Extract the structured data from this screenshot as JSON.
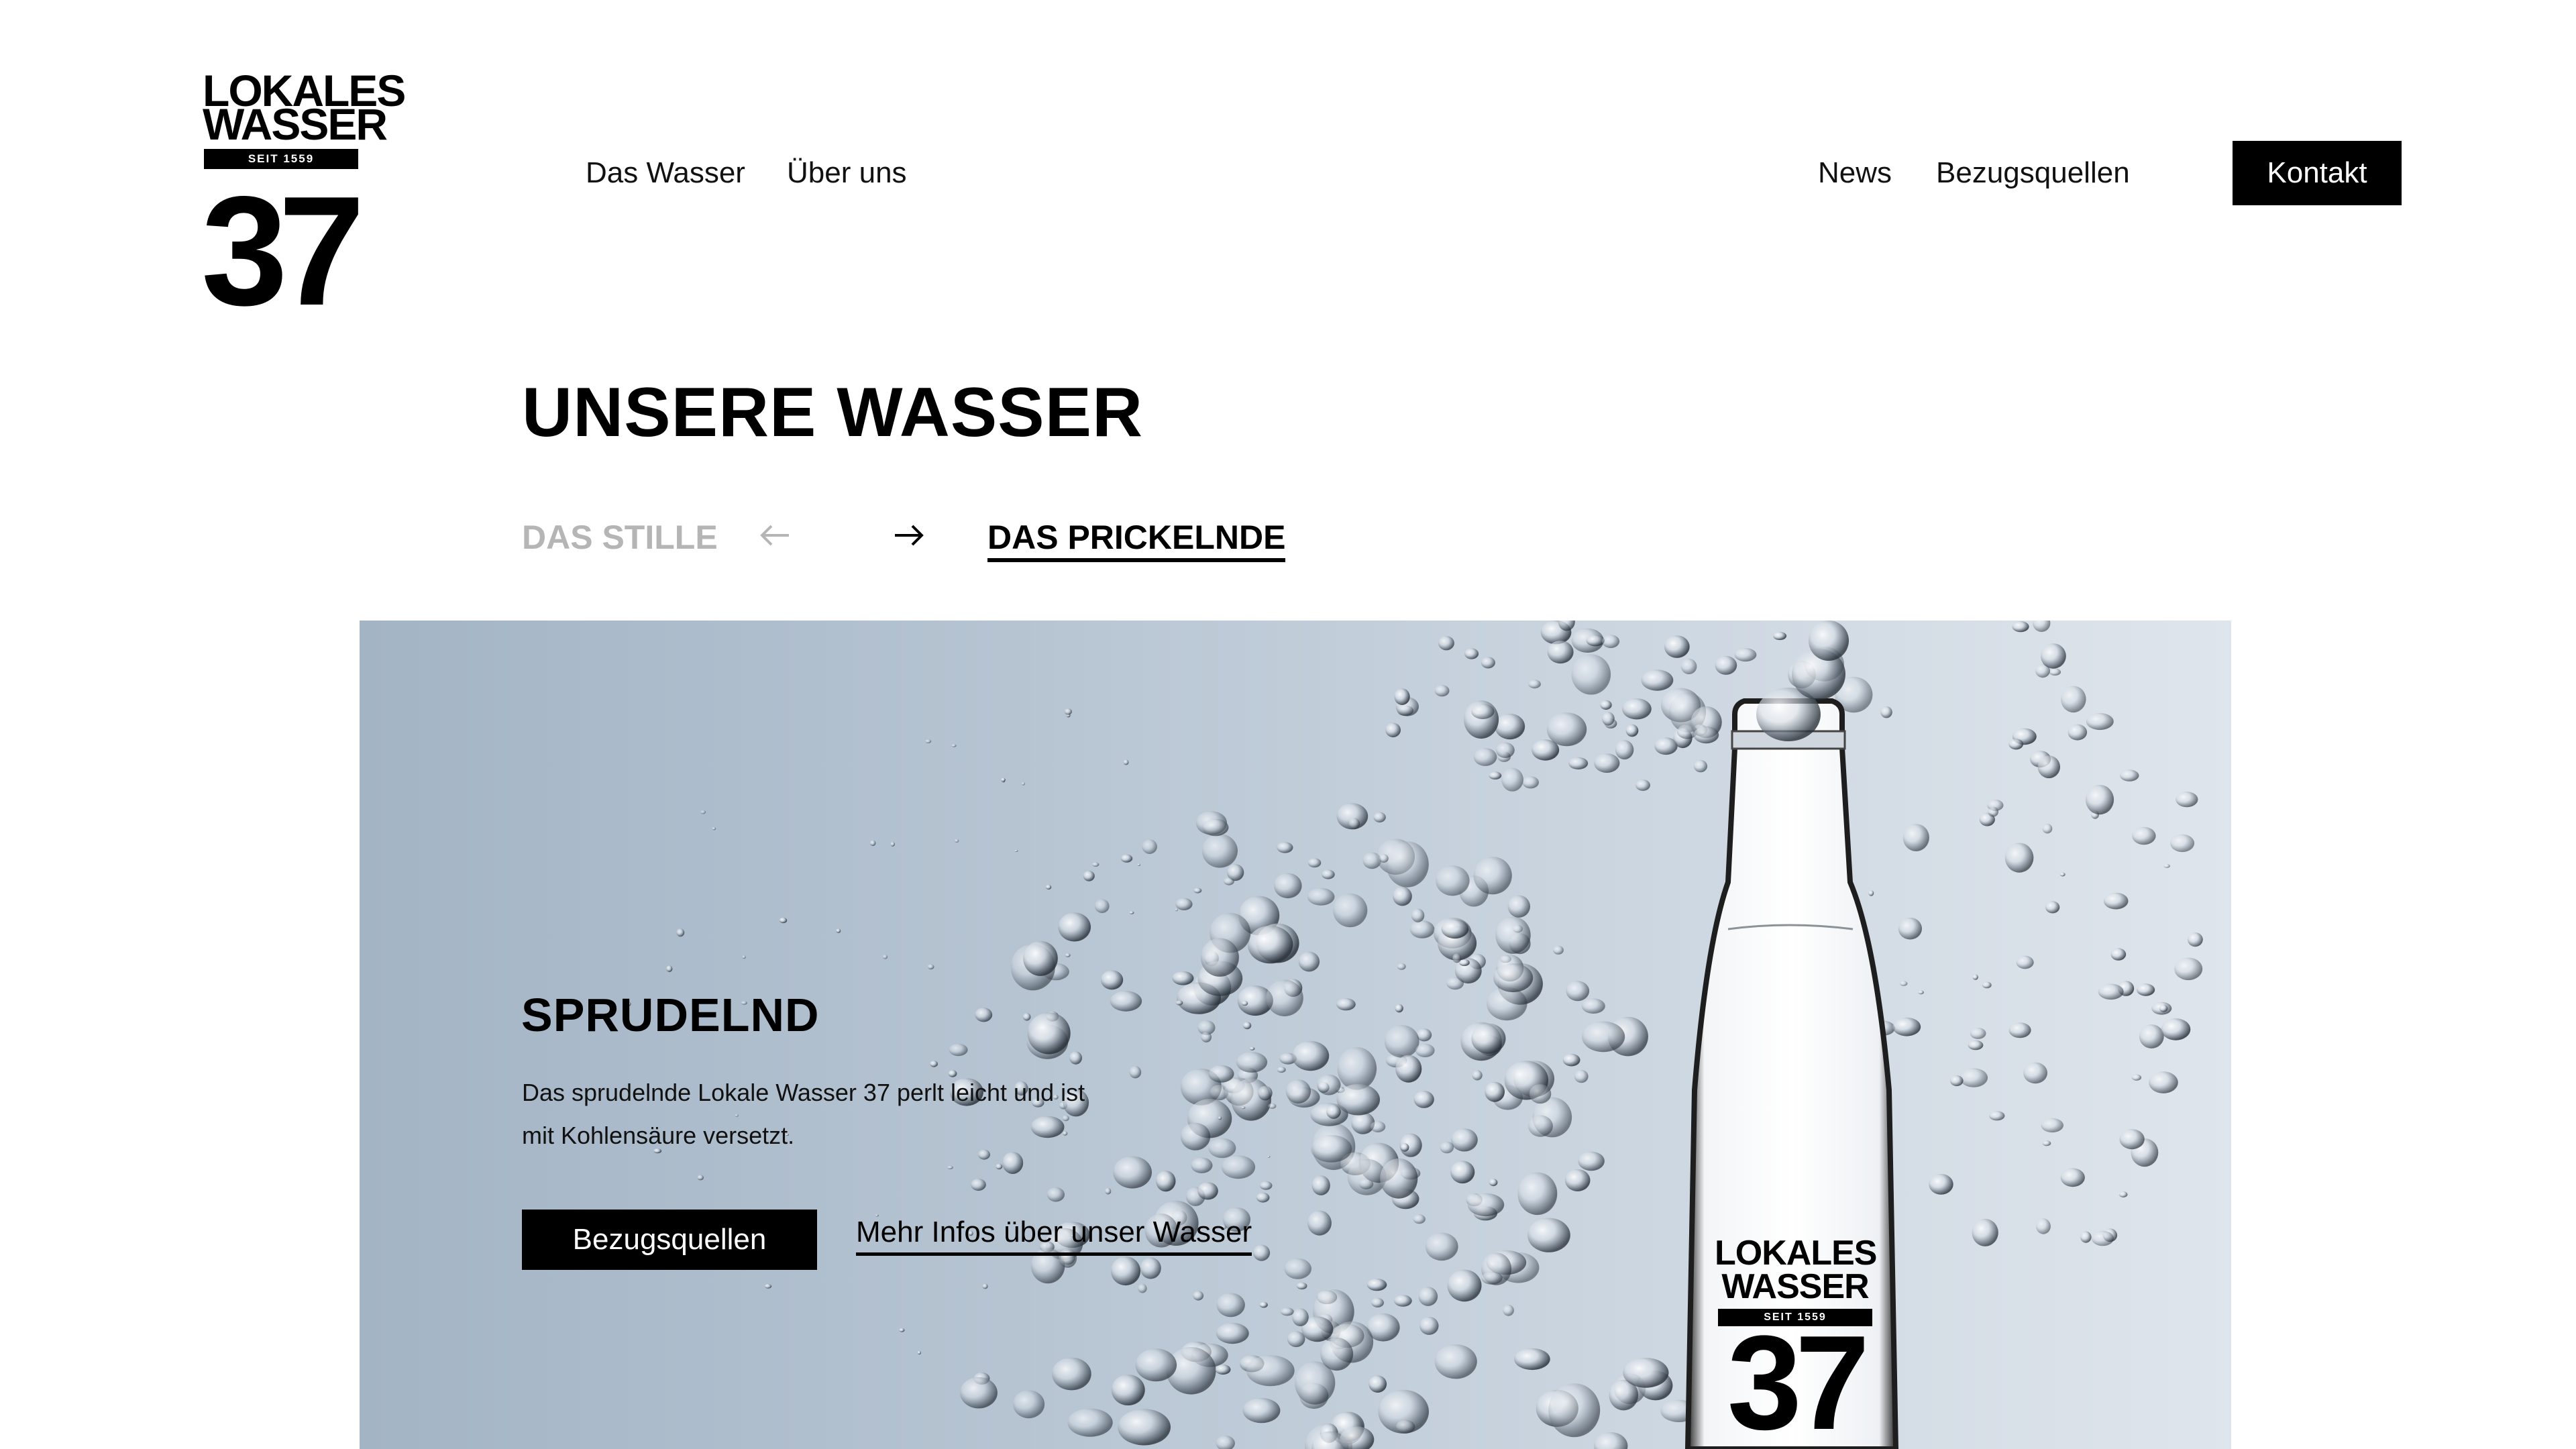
{
  "brand": {
    "logo_line1": "LOKALES",
    "logo_line2": "WASSER",
    "logo_since": "SEIT 1559",
    "logo_number": "37"
  },
  "nav": {
    "left_items": [
      "Das Wasser",
      "Über uns"
    ],
    "right_items": [
      "News",
      "Bezugsquellen"
    ],
    "contact_label": "Kontakt"
  },
  "page": {
    "title": "UNSERE WASSER"
  },
  "switcher": {
    "prev_label": "DAS STILLE",
    "next_label": "DAS PRICKELNDE",
    "prev_icon": "arrow-left-icon",
    "next_icon": "arrow-right-icon"
  },
  "hero": {
    "heading": "SPRUDELND",
    "text_line1": "Das sprudelnde Lokale Wasser 37 perlt leicht und ist",
    "text_line2": "mit Kohlensäure versetzt.",
    "primary_button": "Bezugsquellen",
    "secondary_link": "Mehr Infos über unser Wasser",
    "bottle_label_line1": "LOKALES",
    "bottle_label_line2": "WASSER",
    "bottle_label_since": "SEIT 1559",
    "bottle_label_number": "37"
  },
  "colors": {
    "accent": "#000000",
    "muted": "#b5b5b5",
    "hero_bg_left": "#a3b4c5",
    "hero_bg_right": "#dfe5ec"
  }
}
